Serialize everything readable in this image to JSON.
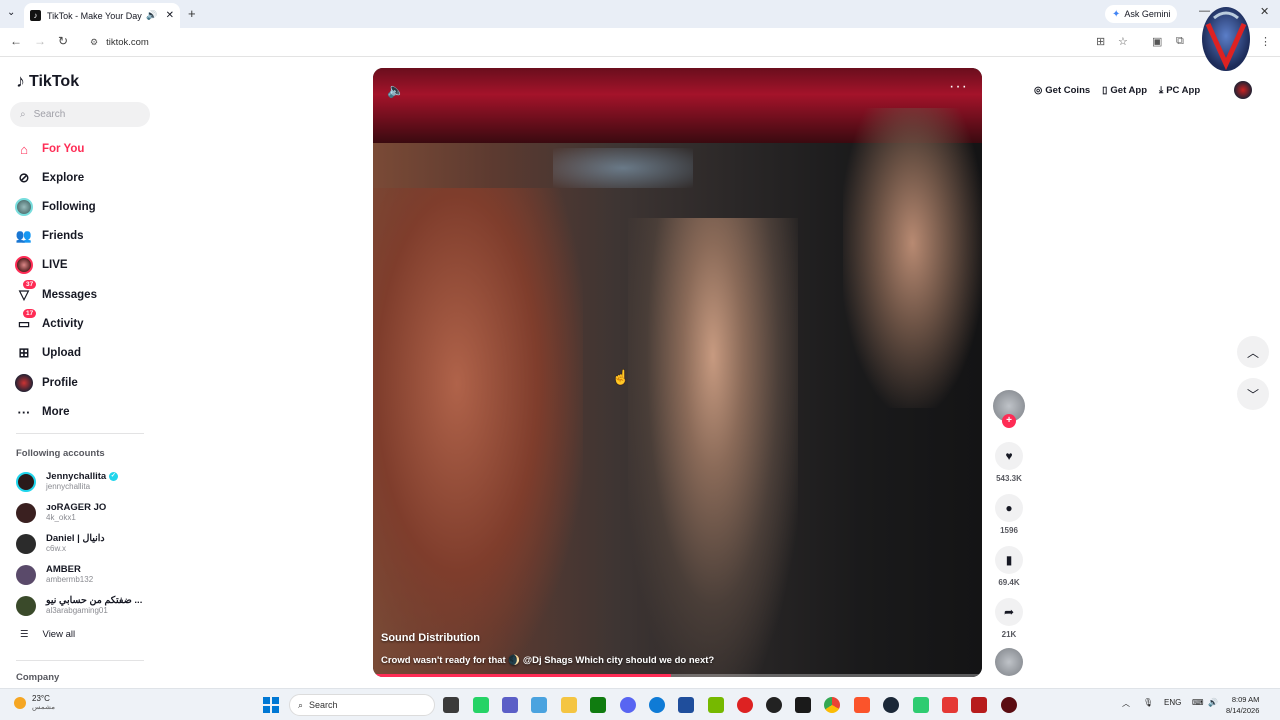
{
  "browser": {
    "tab_title": "TikTok - Make Your Day",
    "tab_close": "✕",
    "new_tab": "+",
    "ask_gemini": "Ask Gemini",
    "url": "tiktok.com",
    "window_controls": [
      "—",
      "▢",
      "✕"
    ]
  },
  "sidebar": {
    "logo": "TikTok",
    "search_placeholder": "Search",
    "nav": [
      {
        "label": "For You",
        "icon": "home-icon",
        "active": true
      },
      {
        "label": "Explore",
        "icon": "compass-icon"
      },
      {
        "label": "Following",
        "icon": "following-avatar-icon"
      },
      {
        "label": "Friends",
        "icon": "friends-icon"
      },
      {
        "label": "LIVE",
        "icon": "live-icon"
      },
      {
        "label": "Messages",
        "icon": "messages-icon",
        "badge": "37"
      },
      {
        "label": "Activity",
        "icon": "activity-icon",
        "badge": "17"
      },
      {
        "label": "Upload",
        "icon": "upload-icon"
      },
      {
        "label": "Profile",
        "icon": "profile-avatar-icon"
      },
      {
        "label": "More",
        "icon": "more-icon"
      }
    ],
    "following_title": "Following accounts",
    "accounts": [
      {
        "name": "Jennychallita",
        "handle": "jennychallita",
        "verified": true,
        "color": "#2a1a1a"
      },
      {
        "name": "ᴊᴏRAGER JO",
        "handle": "4k_okx1",
        "color": "#3a2020"
      },
      {
        "name": "Daniel | دانيال",
        "handle": "c6w.x",
        "color": "#2b2b2b"
      },
      {
        "name": "AMBER",
        "handle": "ambermb132",
        "color": "#5a4a6a"
      },
      {
        "name": "ضفتكم من حسابي نيو ...",
        "handle": "al3arabgaming01",
        "color": "#3a4a2a"
      }
    ],
    "view_all": "View all",
    "company": "Company"
  },
  "video": {
    "author": "Sound Distribution",
    "caption": "Crowd wasn't ready for that 🌒 @Dj Shags Which city should we do next?",
    "progress": 0.49
  },
  "actions": {
    "likes": "543.3K",
    "comments": "1596",
    "saves": "69.4K",
    "shares": "21K"
  },
  "topright": {
    "get_coins": "Get Coins",
    "get_app": "Get App",
    "pc_app": "PC App"
  },
  "taskbar": {
    "temp": "23°C",
    "weather_desc": "مشمس",
    "search": "Search",
    "lang": "ENG",
    "time": "8:09 AM",
    "date": "8/14/2026"
  },
  "colors": {
    "accent": "#fe2c55",
    "verified": "#20d5ec"
  }
}
